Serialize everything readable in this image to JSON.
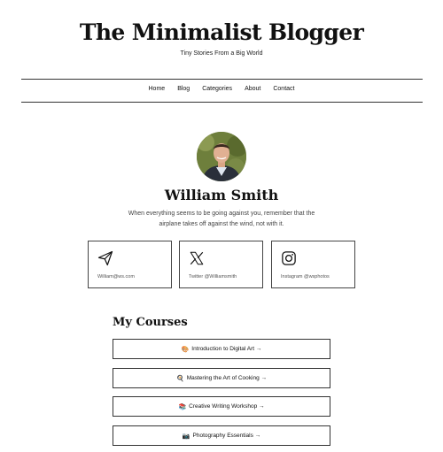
{
  "header": {
    "title": "The Minimalist Blogger",
    "tagline": "Tiny Stories From a Big World"
  },
  "nav": {
    "items": [
      "Home",
      "Blog",
      "Categories",
      "About",
      "Contact"
    ]
  },
  "profile": {
    "name": "William Smith",
    "bio_line1": "When everything seems to be going against you, remember that the",
    "bio_line2": "airplane takes off against the wind, not with it."
  },
  "contacts": [
    {
      "icon": "paper-plane-icon",
      "label": "William@ws.com"
    },
    {
      "icon": "x-twitter-icon",
      "label": "Twitter @Williamsmith"
    },
    {
      "icon": "instagram-icon",
      "label": "Instagram @wsphotos"
    }
  ],
  "courses": {
    "heading": "My Courses",
    "items": [
      {
        "emoji": "🎨",
        "label": "Introduction to Digital Art →"
      },
      {
        "emoji": "🍳",
        "label": "Mastering the Art of Cooking →"
      },
      {
        "emoji": "📚",
        "label": "Creative Writing Workshop →"
      },
      {
        "emoji": "📷",
        "label": "Photography Essentials →"
      }
    ]
  },
  "colors": {
    "text": "#111111",
    "muted": "#444444",
    "border": "#333333",
    "background": "#ffffff"
  }
}
